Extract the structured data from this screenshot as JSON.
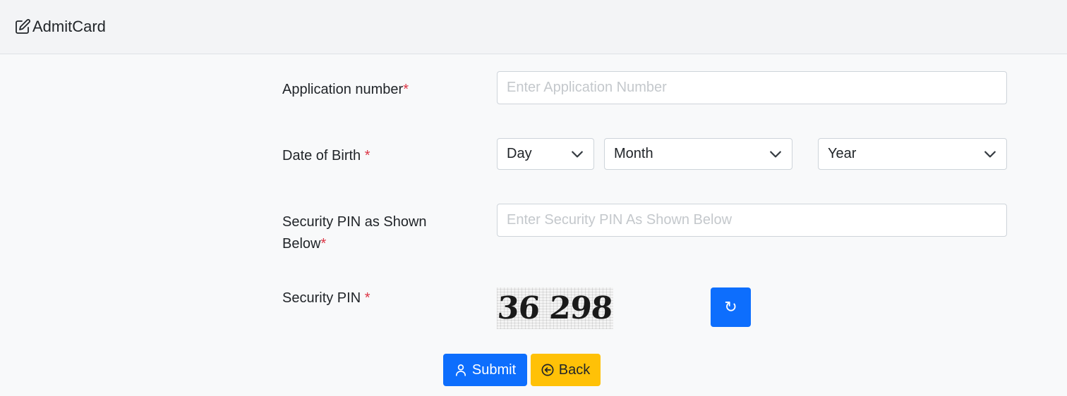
{
  "header": {
    "title": "AdmitCard",
    "icon": "edit-icon"
  },
  "form": {
    "application_number": {
      "label": "Application number",
      "required_mark": "*",
      "placeholder": "Enter Application Number",
      "value": ""
    },
    "dob": {
      "label": "Date of Birth ",
      "required_mark": "*",
      "day": "Day",
      "month": "Month",
      "year": "Year"
    },
    "security_pin_input": {
      "label_line1": "Security PIN as Shown",
      "label_line2": "Below",
      "required_mark": "*",
      "placeholder": "Enter Security PIN As Shown Below",
      "value": ""
    },
    "security_pin": {
      "label": "Security PIN ",
      "required_mark": "*",
      "captcha_text": "36 298",
      "refresh_symbol": "↻"
    }
  },
  "buttons": {
    "submit": "Submit",
    "back": "Back"
  },
  "colors": {
    "primary": "#0d6efd",
    "warning": "#ffc107",
    "required": "#dc3545",
    "header_bg": "#f3f4f6",
    "page_bg": "#f8f9fa"
  }
}
